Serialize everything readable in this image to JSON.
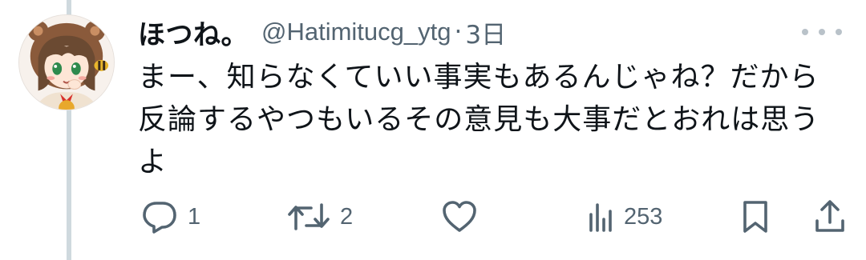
{
  "post": {
    "display_name": "ほつね。",
    "handle": "@Hatimitucg_ytg",
    "separator": "·",
    "time": "3日",
    "text": "まー、知らなくていい事実もあるんじゃね？だから反論するやつもいるその意見も大事だとおれは思うよ"
  },
  "actions": {
    "reply_count": "1",
    "retweet_count": "2",
    "like_count": "",
    "view_count": "253"
  },
  "icons": {
    "more": "more-dots-icon",
    "reply": "reply-bubble-icon",
    "retweet": "retweet-icon",
    "like": "heart-icon",
    "views": "views-chart-icon",
    "bookmark": "bookmark-icon",
    "share": "share-upload-icon"
  },
  "colors": {
    "text": "#0f1419",
    "secondary": "#536471",
    "thread_line": "#cfd9de",
    "background": "#ffffff"
  }
}
